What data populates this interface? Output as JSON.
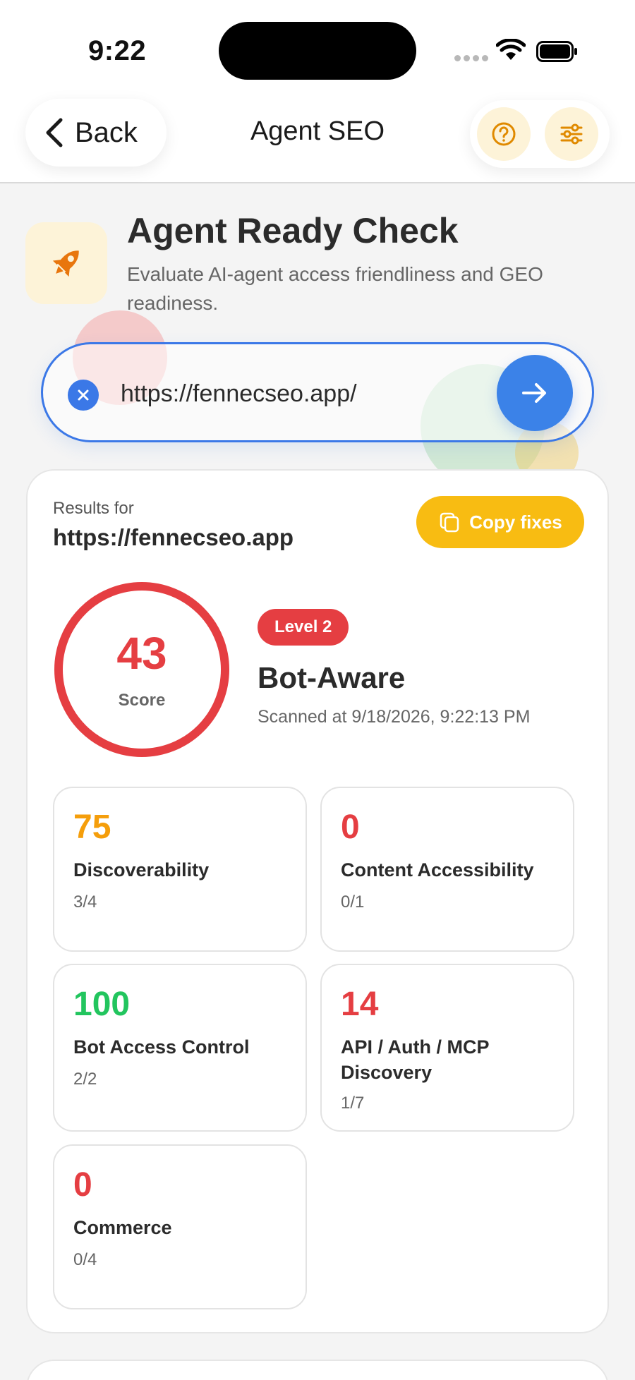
{
  "status_bar": {
    "time": "9:22"
  },
  "header": {
    "back_label": "Back",
    "title": "Agent SEO"
  },
  "hero": {
    "title": "Agent Ready Check",
    "subtitle": "Evaluate AI-agent access friendliness and GEO readiness."
  },
  "search": {
    "value": "https://fennecseo.app/"
  },
  "results": {
    "label": "Results for",
    "url": "https://fennecseo.app",
    "copy_label": "Copy fixes",
    "score": "43",
    "score_label": "Score",
    "score_fraction": 0.43,
    "level_badge": "Level 2",
    "level_name": "Bot-Aware",
    "scanned_at": "Scanned at 9/18/2026, 9:22:13 PM"
  },
  "metrics": [
    {
      "value": "75",
      "name": "Discoverability",
      "sub": "3/4",
      "color": "#f59e0b"
    },
    {
      "value": "0",
      "name": "Content Accessibility",
      "sub": "0/1",
      "color": "#e53e42"
    },
    {
      "value": "100",
      "name": "Bot Access Control",
      "sub": "2/2",
      "color": "#22c55e"
    },
    {
      "value": "14",
      "name": "API / Auth / MCP Discovery",
      "sub": "1/7",
      "color": "#e53e42"
    },
    {
      "value": "0",
      "name": "Commerce",
      "sub": "0/4",
      "color": "#e53e42"
    }
  ],
  "colors": {
    "accent_blue": "#3b78e7",
    "accent_yellow": "#f8bc12",
    "score_red": "#e53e42"
  }
}
